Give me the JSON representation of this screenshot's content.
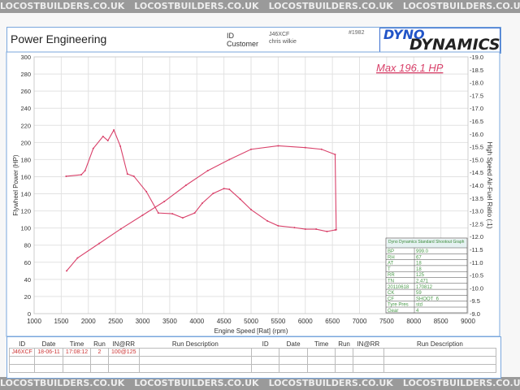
{
  "watermark": "LOCOSTBUILDERS.CO.UK",
  "header": {
    "company": "Power Engineering",
    "id_label": "ID",
    "customer_label": "Customer",
    "id_value": "J46XCF",
    "customer_value": "chris wilkie",
    "sheet_number": "#1982",
    "logo_top": "DYNO",
    "logo_bottom": "DYNAMICS"
  },
  "annotation": "Max 196.1 HP",
  "info_box": {
    "title": "Dyno Dynamics Standard Shootout Graph",
    "rows": [
      [
        "BP",
        "999.0"
      ],
      [
        "RH",
        "67"
      ],
      [
        "AT",
        "18"
      ],
      [
        "T",
        "18"
      ],
      [
        "RR",
        "125"
      ],
      [
        "TN",
        "2.471"
      ],
      [
        "20110618",
        "170812"
      ],
      [
        "CK",
        "59"
      ],
      [
        "CF",
        "SHOOT_6"
      ],
      [
        "Tyre Pres",
        "std"
      ],
      [
        "Gear",
        "4"
      ]
    ]
  },
  "run_table": {
    "headers": [
      "ID",
      "Date",
      "Time",
      "Run",
      "IN@RR",
      "Run Description",
      "ID",
      "Date",
      "Time",
      "Run",
      "IN@RR",
      "Run Description"
    ],
    "rows": [
      [
        "J46XCF",
        "18-06-11",
        "17:08:12",
        "2",
        "100@125",
        "",
        "",
        "",
        "",
        "",
        "",
        ""
      ]
    ]
  },
  "chart_data": {
    "type": "line",
    "xlabel": "Engine Speed [Rat] (rpm)",
    "ylabel": "Flywheel Power (HP)",
    "y2label": "High Speed Air-Fuel Ratio (:1)",
    "xlim": [
      1000,
      9000
    ],
    "ylim": [
      0,
      300
    ],
    "y2lim": [
      9.0,
      19.0
    ],
    "xticks": [
      1000,
      1500,
      2000,
      2500,
      3000,
      3500,
      4000,
      4500,
      5000,
      5500,
      6000,
      6500,
      7000,
      7500,
      8000,
      8500,
      9000
    ],
    "yticks": [
      0,
      20,
      40,
      60,
      80,
      100,
      120,
      140,
      160,
      180,
      200,
      220,
      240,
      260,
      280,
      300
    ],
    "y2ticks": [
      "9.0",
      "9.5",
      "10.0",
      "10.5",
      "11.0",
      "11.5",
      "12.0",
      "12.5",
      "13.0",
      "13.5",
      "14.0",
      "14.5",
      "15.0",
      "15.5",
      "16.0",
      "16.5",
      "17.0",
      "17.5",
      "18.0",
      "18.5",
      "19.0"
    ],
    "grid": true,
    "color": "#d9416a",
    "series": [
      {
        "name": "Power",
        "axis": "left",
        "x": [
          1600,
          1800,
          2200,
          2600,
          3000,
          3400,
          3800,
          4200,
          4600,
          5000,
          5500,
          6000,
          6300,
          6550,
          6570
        ],
        "y": [
          50,
          65,
          82,
          99,
          115,
          131,
          150,
          167,
          180,
          192,
          196.1,
          194,
          192,
          186,
          98
        ]
      },
      {
        "name": "AFR",
        "axis": "right",
        "x": [
          1590,
          1870,
          1940,
          2090,
          2270,
          2360,
          2470,
          2590,
          2720,
          2840,
          3070,
          3290,
          3550,
          3740,
          3960,
          4100,
          4300,
          4500,
          4600,
          4800,
          5000,
          5300,
          5500,
          5800,
          6000,
          6200,
          6400,
          6550
        ],
        "y": [
          14.35,
          14.41,
          14.57,
          15.43,
          15.9,
          15.74,
          16.15,
          15.52,
          14.44,
          14.35,
          13.75,
          12.92,
          12.89,
          12.73,
          12.92,
          13.3,
          13.68,
          13.87,
          13.84,
          13.46,
          13.05,
          12.61,
          12.42,
          12.35,
          12.29,
          12.29,
          12.2,
          12.26
        ]
      }
    ]
  }
}
